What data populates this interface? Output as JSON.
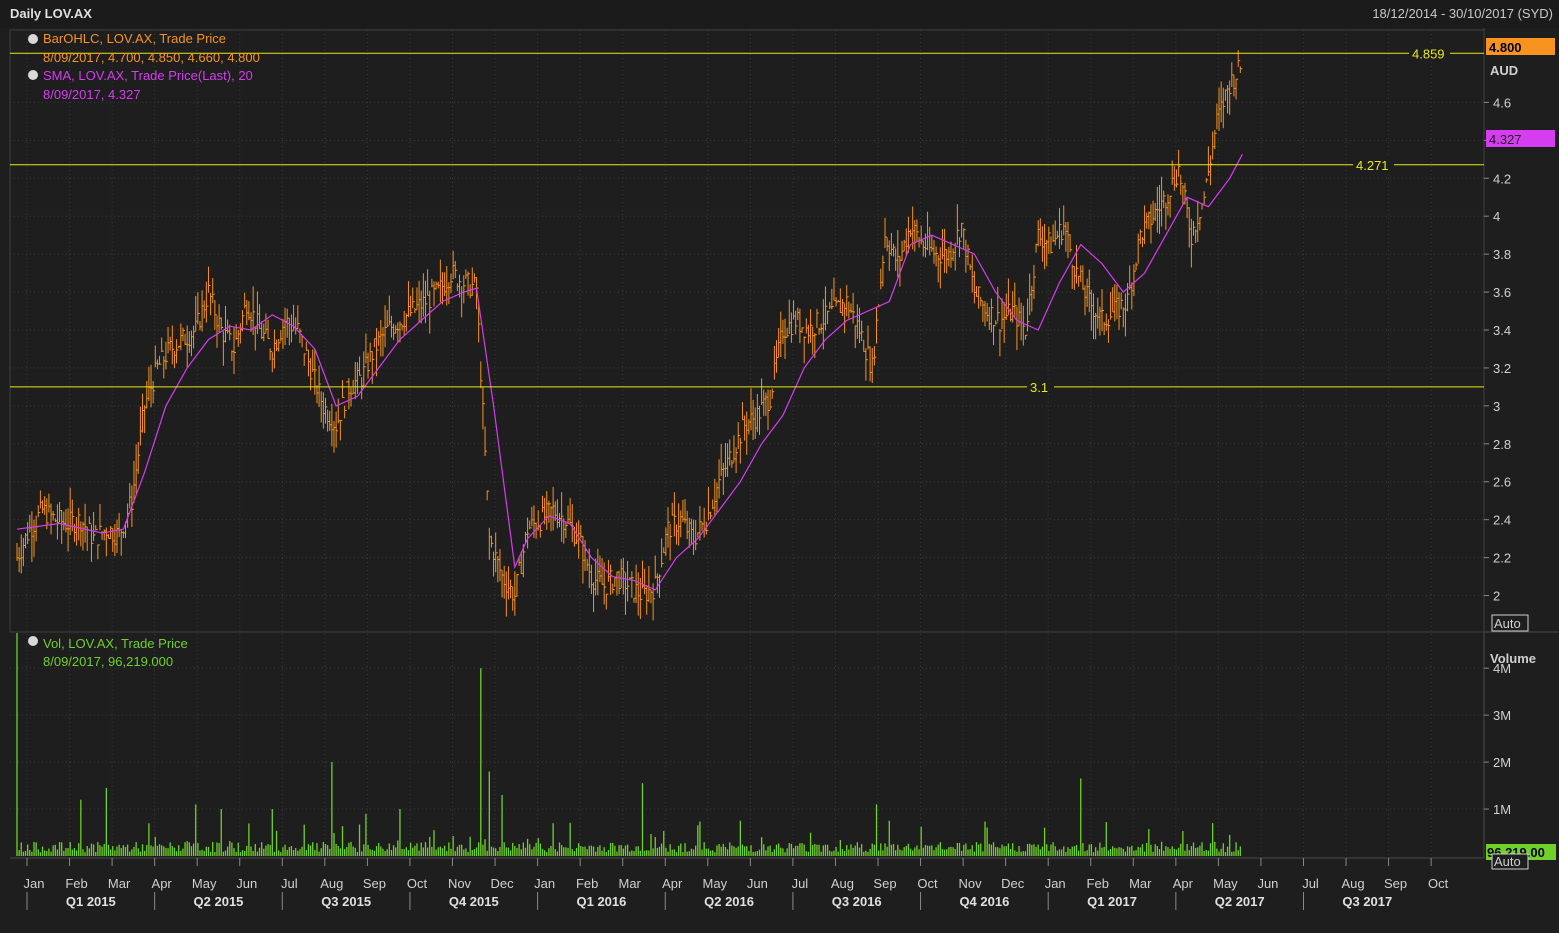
{
  "header": {
    "title": "Daily LOV.AX",
    "range": "18/12/2014 - 30/10/2017 (SYD)"
  },
  "legend": {
    "ohlc_name": "BarOHLC, LOV.AX, Trade Price",
    "ohlc_value": "8/09/2017, 4.700, 4.850, 4.660, 4.800",
    "sma_name": "SMA, LOV.AX, Trade Price(Last),  20",
    "sma_value": "8/09/2017, 4.327",
    "vol_name": "Vol, LOV.AX, Trade Price",
    "vol_value": "8/09/2017, 96,219.000"
  },
  "axis": {
    "price_unit": "AUD",
    "vol_unit": "Volume",
    "auto_label": "Auto",
    "last_price_tag": "4.800",
    "sma_tag": "4.327",
    "vol_tag": "96,219.00",
    "price_ticks": [
      "2",
      "2.2",
      "2.4",
      "2.6",
      "2.8",
      "3",
      "3.2",
      "3.4",
      "3.6",
      "3.8",
      "4",
      "4.2",
      "4.4",
      "4.6"
    ],
    "vol_ticks": [
      "1M",
      "2M",
      "3M",
      "4M"
    ]
  },
  "colors": {
    "ohlc": "#f7931e",
    "sma": "#d63cf0",
    "volume": "#6fd12a",
    "hline": "#e8e81a",
    "grid": "#3a3a3a"
  },
  "chart_data": {
    "type": "line",
    "title": "Daily LOV.AX",
    "x_range": [
      "18/12/2014",
      "30/10/2017"
    ],
    "ylim": [
      1.85,
      4.95
    ],
    "vol_ylim": [
      0,
      4.6
    ],
    "months": [
      "Jan",
      "Feb",
      "Mar",
      "Apr",
      "May",
      "Jun",
      "Jul",
      "Aug",
      "Sep",
      "Oct",
      "Nov",
      "Dec",
      "Jan",
      "Feb",
      "Mar",
      "Apr",
      "May",
      "Jun",
      "Jul",
      "Aug",
      "Sep",
      "Oct",
      "Nov",
      "Dec",
      "Jan",
      "Feb",
      "Mar",
      "Apr",
      "May",
      "Jun",
      "Jul",
      "Aug",
      "Sep",
      "Oct"
    ],
    "quarters": [
      "Q1 2015",
      "Q2 2015",
      "Q3 2015",
      "Q4 2015",
      "Q1 2016",
      "Q2 2016",
      "Q3 2016",
      "Q4 2016",
      "Q1 2017",
      "Q2 2017",
      "Q3 2017"
    ],
    "horizontal_lines": [
      {
        "label": "4.859",
        "value": 4.859
      },
      {
        "label": "4.271",
        "value": 4.271
      },
      {
        "label": "3.1",
        "value": 3.1
      }
    ],
    "price_path": [
      [
        0,
        2.2
      ],
      [
        0.3,
        2.35
      ],
      [
        0.6,
        2.45
      ],
      [
        0.9,
        2.4
      ],
      [
        1.2,
        2.38
      ],
      [
        1.5,
        2.4
      ],
      [
        1.8,
        2.3
      ],
      [
        2.1,
        2.35
      ],
      [
        2.4,
        2.32
      ],
      [
        2.7,
        2.5
      ],
      [
        3.0,
        3.0
      ],
      [
        3.3,
        3.2
      ],
      [
        3.6,
        3.3
      ],
      [
        3.9,
        3.35
      ],
      [
        4.2,
        3.4
      ],
      [
        4.5,
        3.6
      ],
      [
        4.8,
        3.4
      ],
      [
        5.1,
        3.3
      ],
      [
        5.4,
        3.55
      ],
      [
        5.7,
        3.4
      ],
      [
        6.0,
        3.3
      ],
      [
        6.3,
        3.45
      ],
      [
        6.6,
        3.4
      ],
      [
        6.9,
        3.2
      ],
      [
        7.2,
        3.0
      ],
      [
        7.5,
        2.9
      ],
      [
        7.8,
        3.1
      ],
      [
        8.1,
        3.15
      ],
      [
        8.4,
        3.3
      ],
      [
        8.7,
        3.4
      ],
      [
        9.0,
        3.45
      ],
      [
        9.3,
        3.5
      ],
      [
        9.6,
        3.55
      ],
      [
        9.9,
        3.6
      ],
      [
        10.2,
        3.7
      ],
      [
        10.5,
        3.65
      ],
      [
        10.8,
        3.62
      ],
      [
        11.1,
        2.3
      ],
      [
        11.4,
        2.1
      ],
      [
        11.7,
        2.0
      ],
      [
        12.0,
        2.35
      ],
      [
        12.3,
        2.4
      ],
      [
        12.6,
        2.45
      ],
      [
        12.9,
        2.4
      ],
      [
        13.2,
        2.3
      ],
      [
        13.5,
        2.1
      ],
      [
        13.8,
        2.05
      ],
      [
        14.1,
        2.1
      ],
      [
        14.4,
        2.05
      ],
      [
        14.7,
        2.0
      ],
      [
        15.0,
        2.05
      ],
      [
        15.3,
        2.35
      ],
      [
        15.6,
        2.4
      ],
      [
        15.9,
        2.3
      ],
      [
        16.2,
        2.4
      ],
      [
        16.5,
        2.6
      ],
      [
        16.8,
        2.75
      ],
      [
        17.1,
        2.9
      ],
      [
        17.4,
        2.95
      ],
      [
        17.7,
        3.05
      ],
      [
        18.0,
        3.4
      ],
      [
        18.3,
        3.45
      ],
      [
        18.6,
        3.4
      ],
      [
        18.9,
        3.45
      ],
      [
        19.2,
        3.5
      ],
      [
        19.5,
        3.55
      ],
      [
        19.8,
        3.4
      ],
      [
        20.1,
        3.2
      ],
      [
        20.4,
        3.9
      ],
      [
        20.7,
        3.75
      ],
      [
        21.0,
        3.95
      ],
      [
        21.3,
        3.85
      ],
      [
        21.6,
        3.8
      ],
      [
        21.9,
        3.8
      ],
      [
        22.2,
        3.95
      ],
      [
        22.5,
        3.6
      ],
      [
        22.8,
        3.5
      ],
      [
        23.1,
        3.45
      ],
      [
        23.4,
        3.5
      ],
      [
        23.7,
        3.4
      ],
      [
        24.0,
        3.9
      ],
      [
        24.3,
        3.85
      ],
      [
        24.6,
        3.95
      ],
      [
        24.9,
        3.7
      ],
      [
        25.2,
        3.55
      ],
      [
        25.5,
        3.45
      ],
      [
        25.8,
        3.5
      ],
      [
        26.1,
        3.55
      ],
      [
        26.4,
        3.9
      ],
      [
        26.7,
        4.0
      ],
      [
        27.0,
        4.1
      ],
      [
        27.3,
        4.25
      ],
      [
        27.6,
        3.9
      ],
      [
        27.9,
        4.1
      ],
      [
        28.2,
        4.5
      ],
      [
        28.5,
        4.7
      ],
      [
        28.8,
        4.8
      ]
    ],
    "sma_path": [
      [
        0,
        2.35
      ],
      [
        1.0,
        2.38
      ],
      [
        2.0,
        2.33
      ],
      [
        2.5,
        2.35
      ],
      [
        3.0,
        2.65
      ],
      [
        3.5,
        3.0
      ],
      [
        4.0,
        3.2
      ],
      [
        4.5,
        3.35
      ],
      [
        5.0,
        3.42
      ],
      [
        5.5,
        3.4
      ],
      [
        6.0,
        3.48
      ],
      [
        6.5,
        3.42
      ],
      [
        7.0,
        3.3
      ],
      [
        7.5,
        3.0
      ],
      [
        8.0,
        3.05
      ],
      [
        8.5,
        3.2
      ],
      [
        9.0,
        3.35
      ],
      [
        9.5,
        3.45
      ],
      [
        10.0,
        3.55
      ],
      [
        10.5,
        3.6
      ],
      [
        10.8,
        3.62
      ],
      [
        11.2,
        3.0
      ],
      [
        11.7,
        2.15
      ],
      [
        12.0,
        2.3
      ],
      [
        12.5,
        2.42
      ],
      [
        13.0,
        2.38
      ],
      [
        13.5,
        2.2
      ],
      [
        14.0,
        2.1
      ],
      [
        14.5,
        2.08
      ],
      [
        15.0,
        2.03
      ],
      [
        15.5,
        2.2
      ],
      [
        16.0,
        2.3
      ],
      [
        16.5,
        2.45
      ],
      [
        17.0,
        2.6
      ],
      [
        17.5,
        2.8
      ],
      [
        18.0,
        2.95
      ],
      [
        18.5,
        3.2
      ],
      [
        19.0,
        3.35
      ],
      [
        19.5,
        3.45
      ],
      [
        20.0,
        3.5
      ],
      [
        20.5,
        3.55
      ],
      [
        21.0,
        3.85
      ],
      [
        21.5,
        3.9
      ],
      [
        22.0,
        3.85
      ],
      [
        22.5,
        3.8
      ],
      [
        23.0,
        3.6
      ],
      [
        23.5,
        3.45
      ],
      [
        24.0,
        3.4
      ],
      [
        24.5,
        3.65
      ],
      [
        25.0,
        3.85
      ],
      [
        25.5,
        3.75
      ],
      [
        26.0,
        3.6
      ],
      [
        26.5,
        3.7
      ],
      [
        27.0,
        3.9
      ],
      [
        27.5,
        4.1
      ],
      [
        28.0,
        4.05
      ],
      [
        28.5,
        4.2
      ],
      [
        28.8,
        4.327
      ]
    ],
    "volume_spikes": [
      [
        0.02,
        4.75
      ],
      [
        1.5,
        1.2
      ],
      [
        2.1,
        1.45
      ],
      [
        4.2,
        1.1
      ],
      [
        4.8,
        1.0
      ],
      [
        6.0,
        1.0
      ],
      [
        7.4,
        2.0
      ],
      [
        8.2,
        0.9
      ],
      [
        9.0,
        1.0
      ],
      [
        10.9,
        4.0
      ],
      [
        11.1,
        1.8
      ],
      [
        11.4,
        1.3
      ],
      [
        14.7,
        1.55
      ],
      [
        17.0,
        0.75
      ],
      [
        20.2,
        1.1
      ],
      [
        20.5,
        0.75
      ],
      [
        25.0,
        1.65
      ],
      [
        28.1,
        0.7
      ],
      [
        28.5,
        0.45
      ]
    ]
  }
}
